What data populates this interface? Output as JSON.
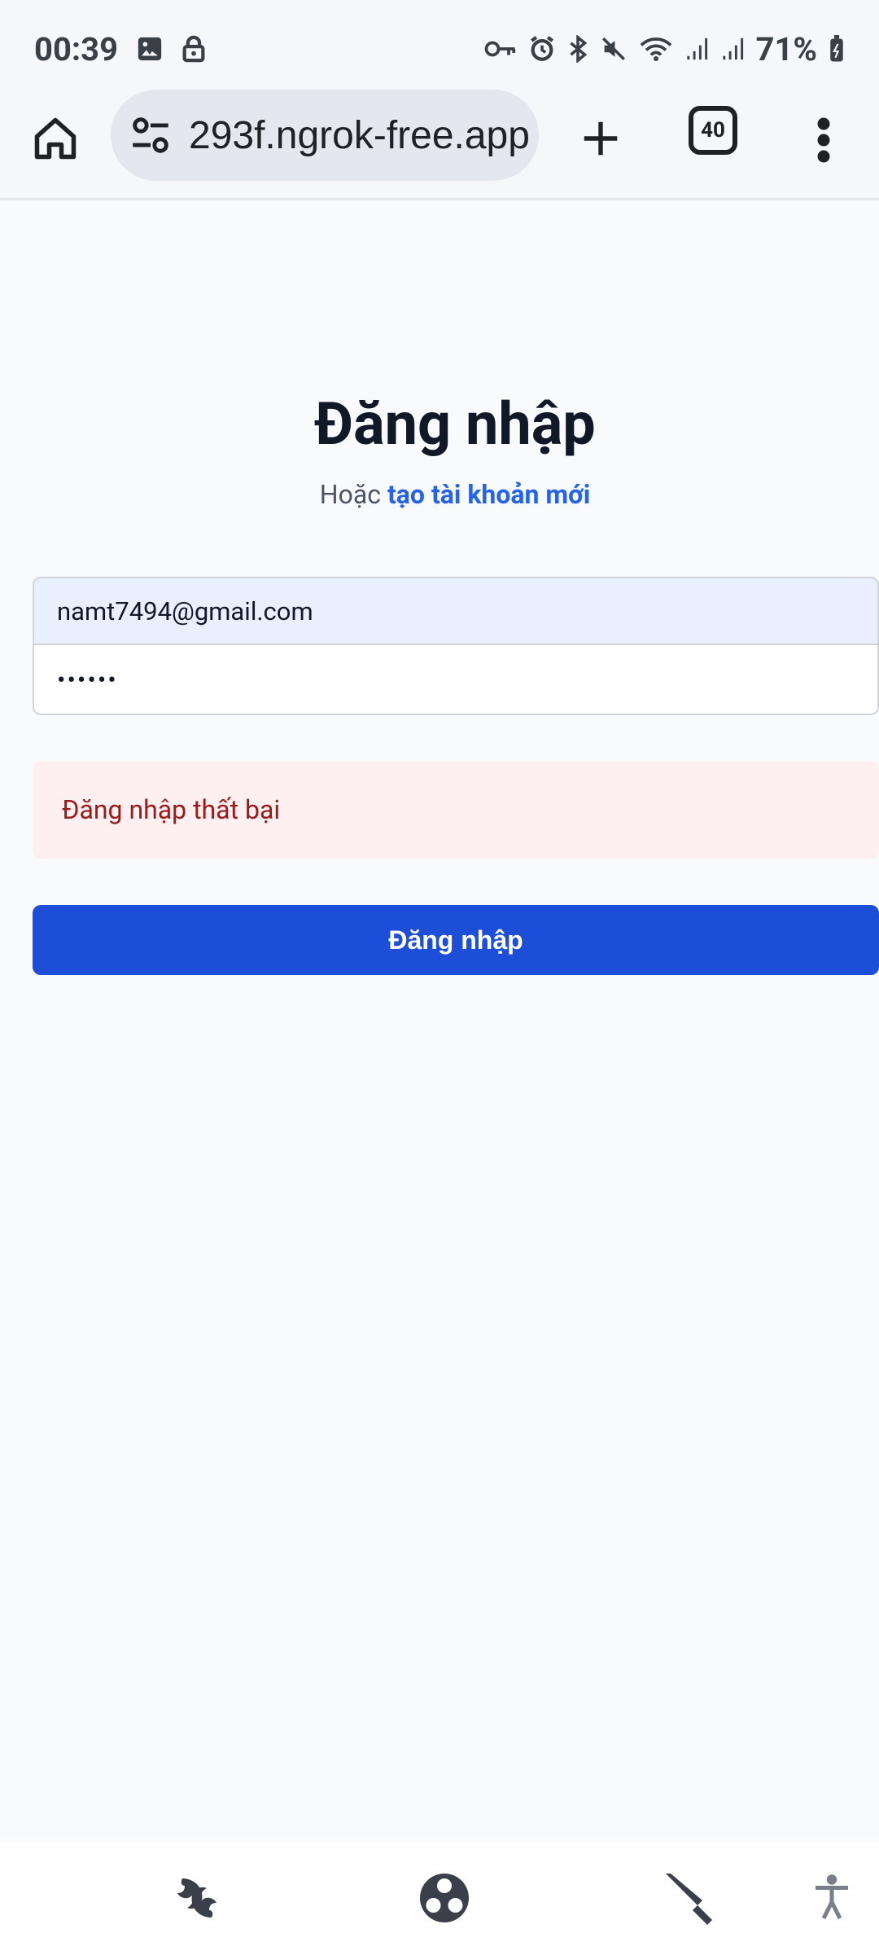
{
  "status_bar": {
    "time": "00:39",
    "battery": "71%",
    "icons": [
      "image-icon",
      "lock-icon",
      "key-icon",
      "alarm-icon",
      "bluetooth-icon",
      "mute-icon",
      "wifi-icon",
      "signal-icon",
      "signal-icon",
      "battery-icon"
    ]
  },
  "browser": {
    "url": "293f.ngrok-free.app",
    "tab_count": "40",
    "icons": [
      "home-icon",
      "site-settings-icon",
      "new-tab-icon",
      "tab-switcher-icon",
      "more-vert-icon"
    ]
  },
  "login": {
    "title": "Đăng nhập",
    "subtitle_prefix": "Hoặc ",
    "subtitle_link": "tạo tài khoản mới",
    "email_value": "namt7494@gmail.com",
    "password_value": "••••••",
    "error_message": "Đăng nhập thất bại",
    "submit_label": "Đăng nhập"
  },
  "colors": {
    "primary": "#1d4ed8",
    "link": "#2563eb",
    "error_bg": "#fef0f0",
    "error_text": "#991b1b",
    "autofill_bg": "#e8f0fe"
  },
  "dock": {
    "items": [
      "koi-fish-icon",
      "aperture-icon",
      "knife-icon",
      "accessibility-icon"
    ]
  }
}
